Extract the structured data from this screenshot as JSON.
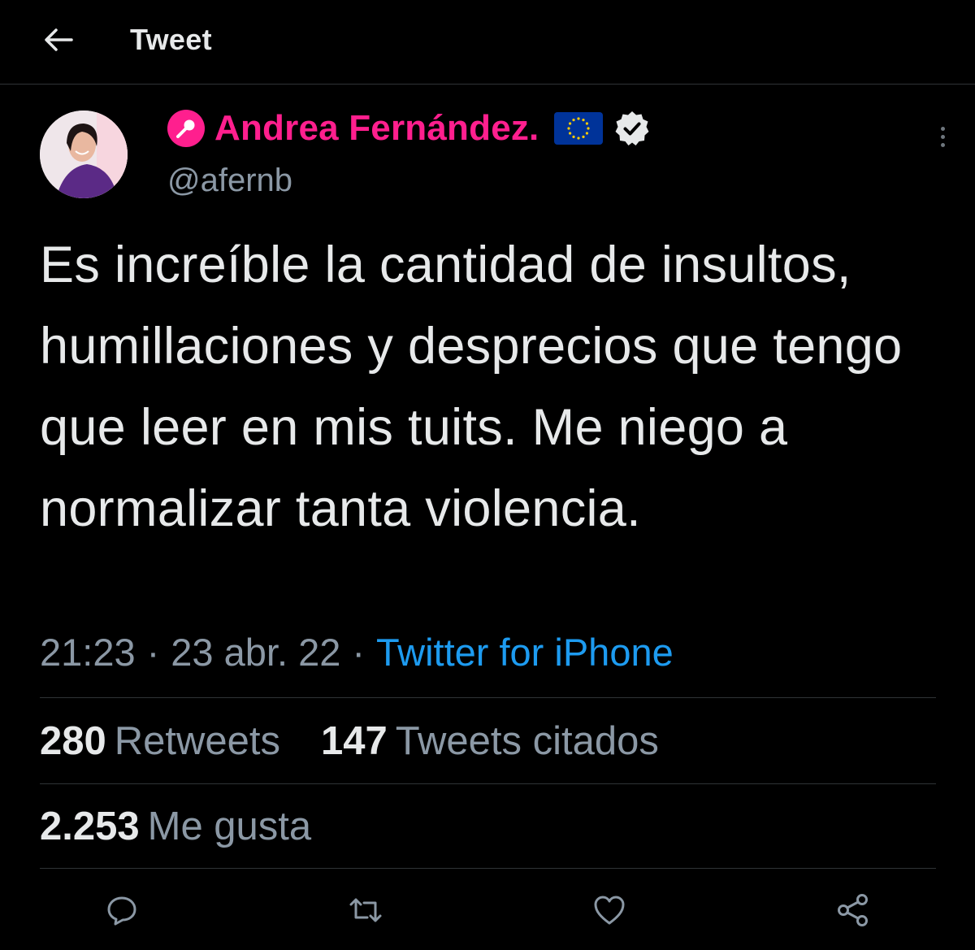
{
  "header": {
    "title": "Tweet",
    "back_icon": "arrow-left-icon"
  },
  "author": {
    "name": "Andrea Fernández.",
    "handle": "@afernb",
    "name_color": "#ff1f8e",
    "badges": [
      "microphone-icon",
      "eu-flag-icon",
      "verified-badge-icon"
    ]
  },
  "tweet": {
    "text": "Es increíble la cantidad de insultos, humillaciones y desprecios que tengo que leer en mis tuits. Me niego a normalizar tanta violencia.",
    "time": "21:23",
    "separator": "·",
    "date": "23 abr. 22",
    "source": "Twitter for iPhone"
  },
  "stats": {
    "retweets_count": "280",
    "retweets_label": "Retweets",
    "quotes_count": "147",
    "quotes_label": "Tweets citados",
    "likes_count": "2.253",
    "likes_label": "Me gusta"
  },
  "actions": [
    "reply-icon",
    "retweet-icon",
    "like-icon",
    "share-icon"
  ],
  "colors": {
    "background": "#000000",
    "text": "#e7e9ea",
    "muted": "#8b98a5",
    "link": "#1d9bf0",
    "divider": "#2f3336"
  }
}
